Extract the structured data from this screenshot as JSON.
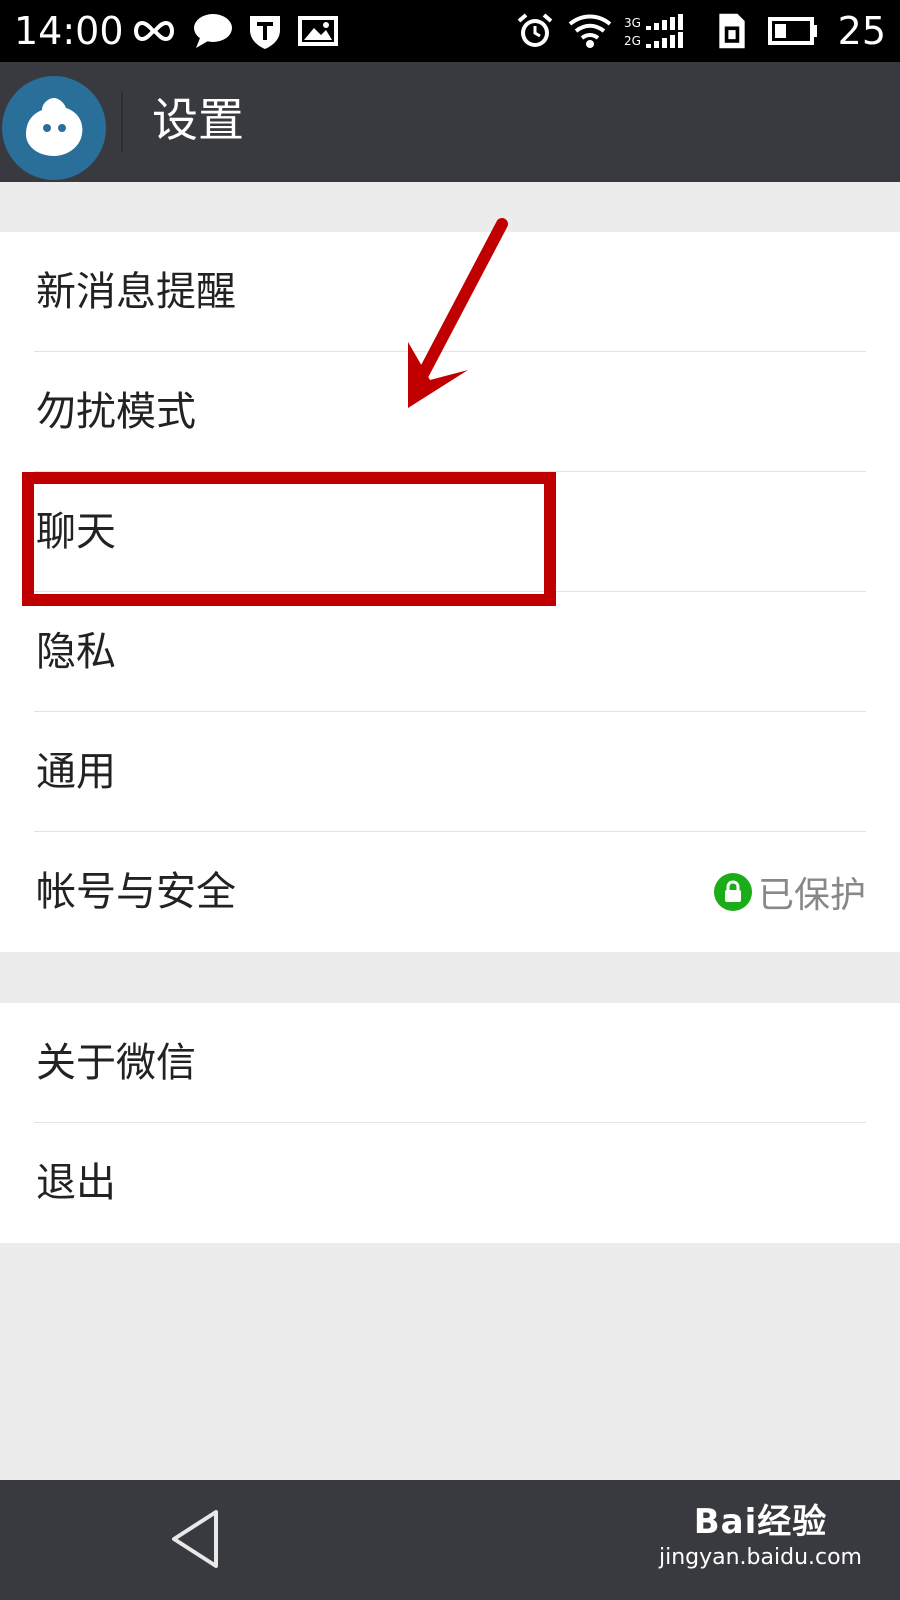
{
  "status_bar": {
    "time": "14:00",
    "battery_level": "25",
    "network": "3G 2G",
    "icons": [
      "infinity-icon",
      "chat-bubble-icon",
      "shield-icon",
      "image-icon",
      "alarm-icon",
      "wifi-icon",
      "signal-icon",
      "sim-icon",
      "battery-icon"
    ]
  },
  "header": {
    "title": "设置",
    "avatar_icon": "app-logo-icon"
  },
  "settings": {
    "group1": [
      {
        "label": "新消息提醒"
      },
      {
        "label": "勿扰模式"
      },
      {
        "label": "聊天"
      },
      {
        "label": "隐私"
      },
      {
        "label": "通用"
      },
      {
        "label": "帐号与安全",
        "status": "已保护",
        "status_icon": "lock-icon"
      }
    ],
    "group2": [
      {
        "label": "关于微信"
      },
      {
        "label": "退出"
      }
    ]
  },
  "annotation": {
    "highlighted_item": "聊天",
    "color": "#c00000"
  },
  "nav_bar": {
    "back_icon": "back-triangle-icon"
  },
  "watermark": {
    "main": "Bai经验",
    "sub": "jingyan.baidu.com"
  },
  "colors": {
    "status_bar": "#000000",
    "action_bar": "#393a3f",
    "background": "#ececec",
    "accent_green": "#1aad19",
    "annotation_red": "#c00000"
  }
}
